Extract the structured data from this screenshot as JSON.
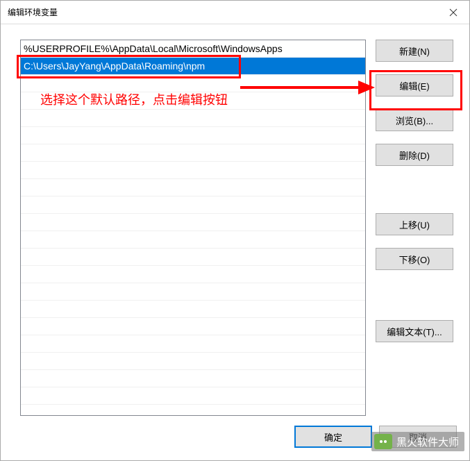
{
  "title": "编辑环境变量",
  "list": {
    "items": [
      "%USERPROFILE%\\AppData\\Local\\Microsoft\\WindowsApps",
      "C:\\Users\\JayYang\\AppData\\Roaming\\npm"
    ],
    "selectedIndex": 1
  },
  "buttons": {
    "new": "新建(N)",
    "edit": "编辑(E)",
    "browse": "浏览(B)...",
    "delete": "删除(D)",
    "moveUp": "上移(U)",
    "moveDown": "下移(O)",
    "editText": "编辑文本(T)...",
    "ok": "确定",
    "cancel": "取消"
  },
  "annotation": {
    "text": "选择这个默认路径，点击编辑按钮"
  },
  "watermark": {
    "text": "黑火软件大师"
  }
}
